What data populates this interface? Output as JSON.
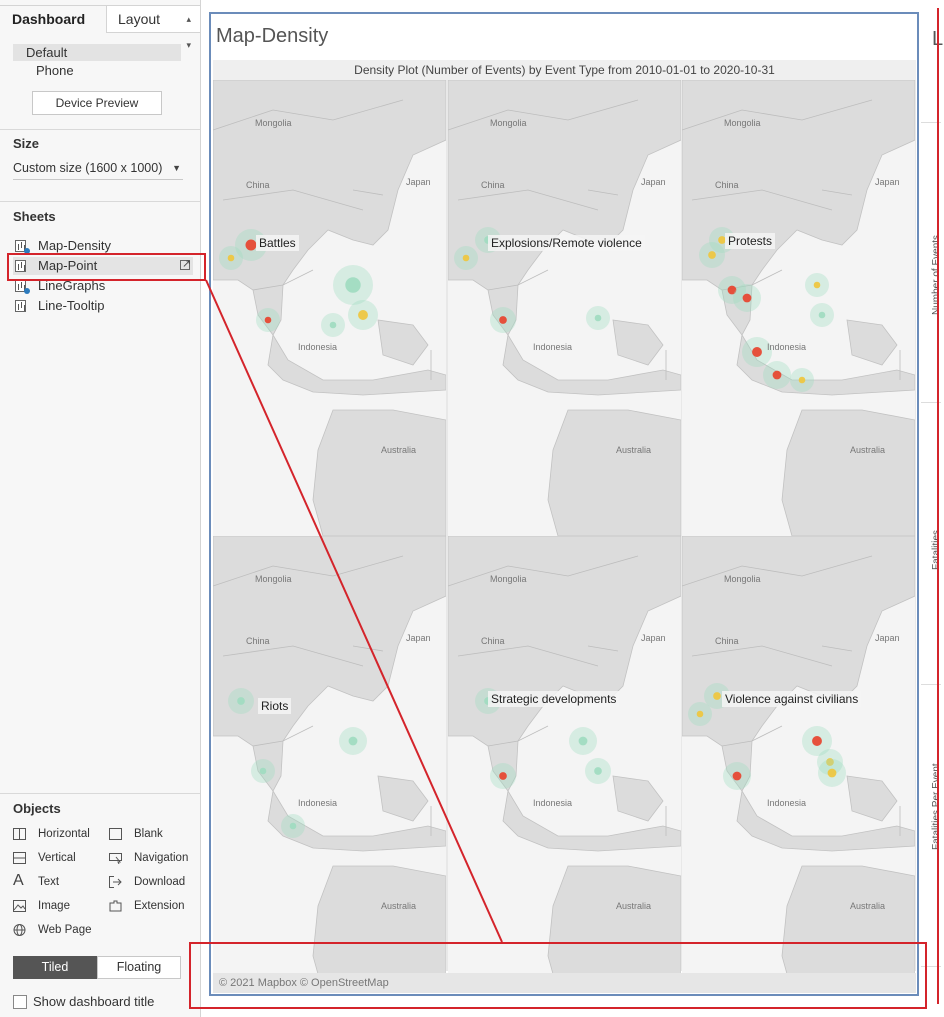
{
  "left_pane": {
    "tabs": {
      "dashboard": "Dashboard",
      "layout": "Layout"
    },
    "devices": {
      "default": "Default",
      "phone": "Phone",
      "preview_button": "Device Preview"
    },
    "size": {
      "title": "Size",
      "value": "Custom size (1600 x 1000)"
    },
    "sheets": {
      "title": "Sheets",
      "items": [
        {
          "label": "Map-Density"
        },
        {
          "label": "Map-Point"
        },
        {
          "label": "LineGraphs"
        },
        {
          "label": "Line-Tooltip"
        }
      ]
    },
    "objects": {
      "title": "Objects",
      "items": [
        {
          "label": "Horizontal",
          "icon": "horizontal-icon"
        },
        {
          "label": "Blank",
          "icon": "blank-icon"
        },
        {
          "label": "Vertical",
          "icon": "vertical-icon"
        },
        {
          "label": "Navigation",
          "icon": "navigation-icon"
        },
        {
          "label": "Text",
          "icon": "text-icon"
        },
        {
          "label": "Download",
          "icon": "download-icon"
        },
        {
          "label": "Image",
          "icon": "image-icon"
        },
        {
          "label": "Extension",
          "icon": "extension-icon"
        },
        {
          "label": "Web Page",
          "icon": "web-page-icon"
        }
      ]
    },
    "layout_mode": {
      "tiled": "Tiled",
      "floating": "Floating"
    },
    "show_title": "Show dashboard title"
  },
  "dashboard": {
    "title": "Map-Density",
    "right_sheet_letter": "L",
    "right_axis_labels": [
      "Number of Events",
      "Fatalities",
      "Fatalities Per Event"
    ],
    "chart_header": "Density Plot (Number of Events) by Event Type from 2010-01-01 to 2020-10-31",
    "map_labels": {
      "mongolia": "Mongolia",
      "china": "China",
      "japan": "Japan",
      "indonesia": "Indonesia",
      "australia": "Australia"
    },
    "panels": [
      {
        "label": "Battles"
      },
      {
        "label": "Explosions/Remote violence"
      },
      {
        "label": "Protests"
      },
      {
        "label": "Riots"
      },
      {
        "label": "Strategic developments"
      },
      {
        "label": "Violence against civilians"
      }
    ],
    "attribution": "© 2021 Mapbox © OpenStreetMap"
  },
  "colors": {
    "frame_blue": "#6b8cba",
    "annotation_red": "#d4242b",
    "hot": "#e8402a",
    "warm": "#f0c53a",
    "cool": "#9fdcc0"
  }
}
